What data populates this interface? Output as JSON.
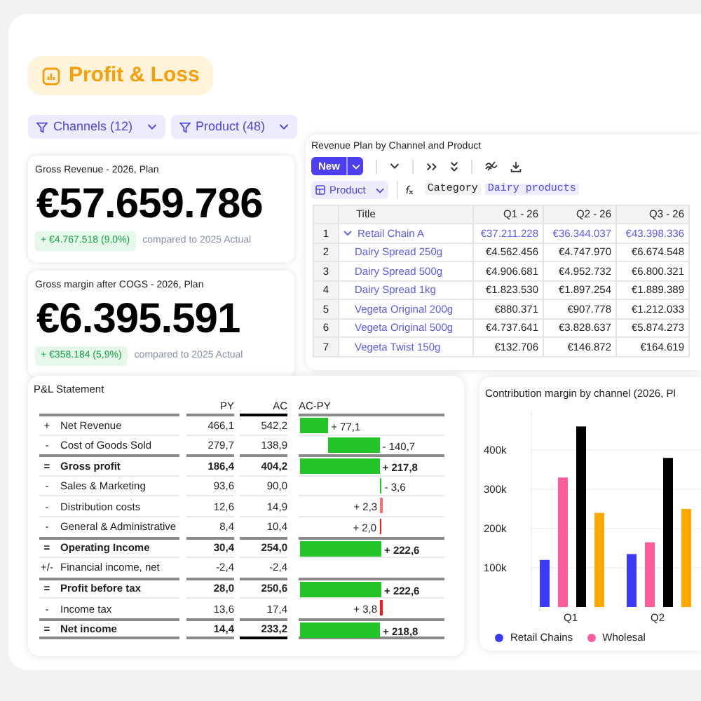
{
  "header": {
    "title": "Profit & Loss"
  },
  "filters": [
    {
      "label": "Channels (12)"
    },
    {
      "label": "Product (48)"
    }
  ],
  "kpis": [
    {
      "title": "Gross Revenue - 2026, Plan",
      "value": "€57.659.786",
      "delta": "+ €4.767.518 (9,0%)",
      "comparison": "compared to 2025 Actual"
    },
    {
      "title": "Gross margin after COGS - 2026, Plan",
      "value": "€6.395.591",
      "delta": "+ €358.184 (5,9%)",
      "comparison": "compared to 2025 Actual"
    }
  ],
  "revenue_plan": {
    "title": "Revenue Plan by Channel and Product",
    "new_button": "New",
    "dimension": "Product",
    "formula_field": "Category",
    "formula_value": "Dairy products",
    "columns": [
      "",
      "Title",
      "Q1 - 26",
      "Q2 - 26",
      "Q3 - 26"
    ],
    "rows": [
      {
        "kind": "group",
        "expanded": true,
        "cells": [
          "1",
          "Retail Chain A",
          "€37.211.228",
          "€36.344.037",
          "€43.398.336"
        ]
      },
      {
        "kind": "item",
        "cells": [
          "2",
          "Dairy Spread 250g",
          "€4.562.456",
          "€4.747.970",
          "€6.674.548"
        ]
      },
      {
        "kind": "item",
        "cells": [
          "3",
          "Dairy Spread 500g",
          "€4.906.681",
          "€4.952.732",
          "€6.800.321"
        ]
      },
      {
        "kind": "item",
        "cells": [
          "4",
          "Dairy Spread 1kg",
          "€1.823.530",
          "€1.897.254",
          "€1.889.389"
        ]
      },
      {
        "kind": "item",
        "cells": [
          "5",
          "Vegeta Original 200g",
          "€880.371",
          "€907.778",
          "€1.212.033"
        ]
      },
      {
        "kind": "item",
        "cells": [
          "6",
          "Vegeta Original 500g",
          "€4.737.641",
          "€3.828.637",
          "€5.874.273"
        ]
      },
      {
        "kind": "item",
        "cells": [
          "7",
          "Vegeta Twist 150g",
          "€132.706",
          "€146.872",
          "€164.619"
        ]
      }
    ]
  },
  "pl_statement": {
    "title": "P&L Statement",
    "columns": [
      "PY",
      "AC",
      "AC-PY"
    ],
    "rows": [
      {
        "sign": "+",
        "label": "Net Revenue",
        "kind": "line",
        "py": "466,1",
        "ac": "542,2",
        "delta": "+ 77,1",
        "color": "#22c527"
      },
      {
        "sign": "-",
        "label": "Cost of Goods Sold",
        "kind": "line",
        "py": "279,7",
        "ac": "138,9",
        "delta": "- 140,7",
        "color": "#22c527"
      },
      {
        "sign": "=",
        "label": "Gross profit",
        "kind": "total",
        "py": "186,4",
        "ac": "404,2",
        "delta": "+ 217,8",
        "color": "#22c527"
      },
      {
        "sign": "-",
        "label": "Sales & Marketing",
        "kind": "line",
        "py": "93,6",
        "ac": "90,0",
        "delta": "- 3,6",
        "color": "#22c527"
      },
      {
        "sign": "-",
        "label": "Distribution costs",
        "kind": "line",
        "py": "12,6",
        "ac": "14,9",
        "delta": "+ 2,3",
        "color": "#f87171"
      },
      {
        "sign": "-",
        "label": "General & Administrative",
        "kind": "line",
        "py": "8,4",
        "ac": "10,4",
        "delta": "+ 2,0",
        "color": "#ef1c1c"
      },
      {
        "sign": "=",
        "label": "Operating Income",
        "kind": "total",
        "py": "30,4",
        "ac": "254,0",
        "delta": "+ 222,6",
        "color": "#22c527"
      },
      {
        "sign": "+/-",
        "label": "Financial income, net",
        "kind": "line",
        "py": "-2,4",
        "ac": "-2,4"
      },
      {
        "sign": "=",
        "label": "Profit before tax",
        "kind": "total",
        "py": "28,0",
        "ac": "250,6",
        "delta": "+ 222,6",
        "color": "#22c527"
      },
      {
        "sign": "-",
        "label": "Income tax",
        "kind": "line",
        "py": "13,6",
        "ac": "17,4",
        "delta": "+ 3,8",
        "color": "#ef1c1c"
      },
      {
        "sign": "=",
        "label": "Net income",
        "kind": "total",
        "py": "14,4",
        "ac": "233,2",
        "delta": "+ 218,8",
        "color": "#22c527"
      }
    ]
  },
  "margin_chart": {
    "chart_data": {
      "type": "bar",
      "title": "Contribution margin by channel (2026, Pl",
      "categories": [
        "Q1",
        "Q2"
      ],
      "series": [
        {
          "name": "Retail Chains",
          "color": "#3b3bf5",
          "values": [
            120000,
            135000
          ]
        },
        {
          "name": "Wholesal",
          "color": "#ff5c9d",
          "values": [
            330000,
            165000
          ]
        },
        {
          "color": "#000000",
          "values": [
            460000,
            380000
          ]
        },
        {
          "color": "#ffa800",
          "values": [
            240000,
            250000
          ]
        }
      ],
      "ylim": [
        0,
        500000
      ],
      "grid": true,
      "yticks": [
        {
          "value": 100000,
          "label": "100k"
        },
        {
          "value": 200000,
          "label": "200k"
        },
        {
          "value": 300000,
          "label": "300k"
        },
        {
          "value": 400000,
          "label": "400k"
        }
      ]
    }
  }
}
